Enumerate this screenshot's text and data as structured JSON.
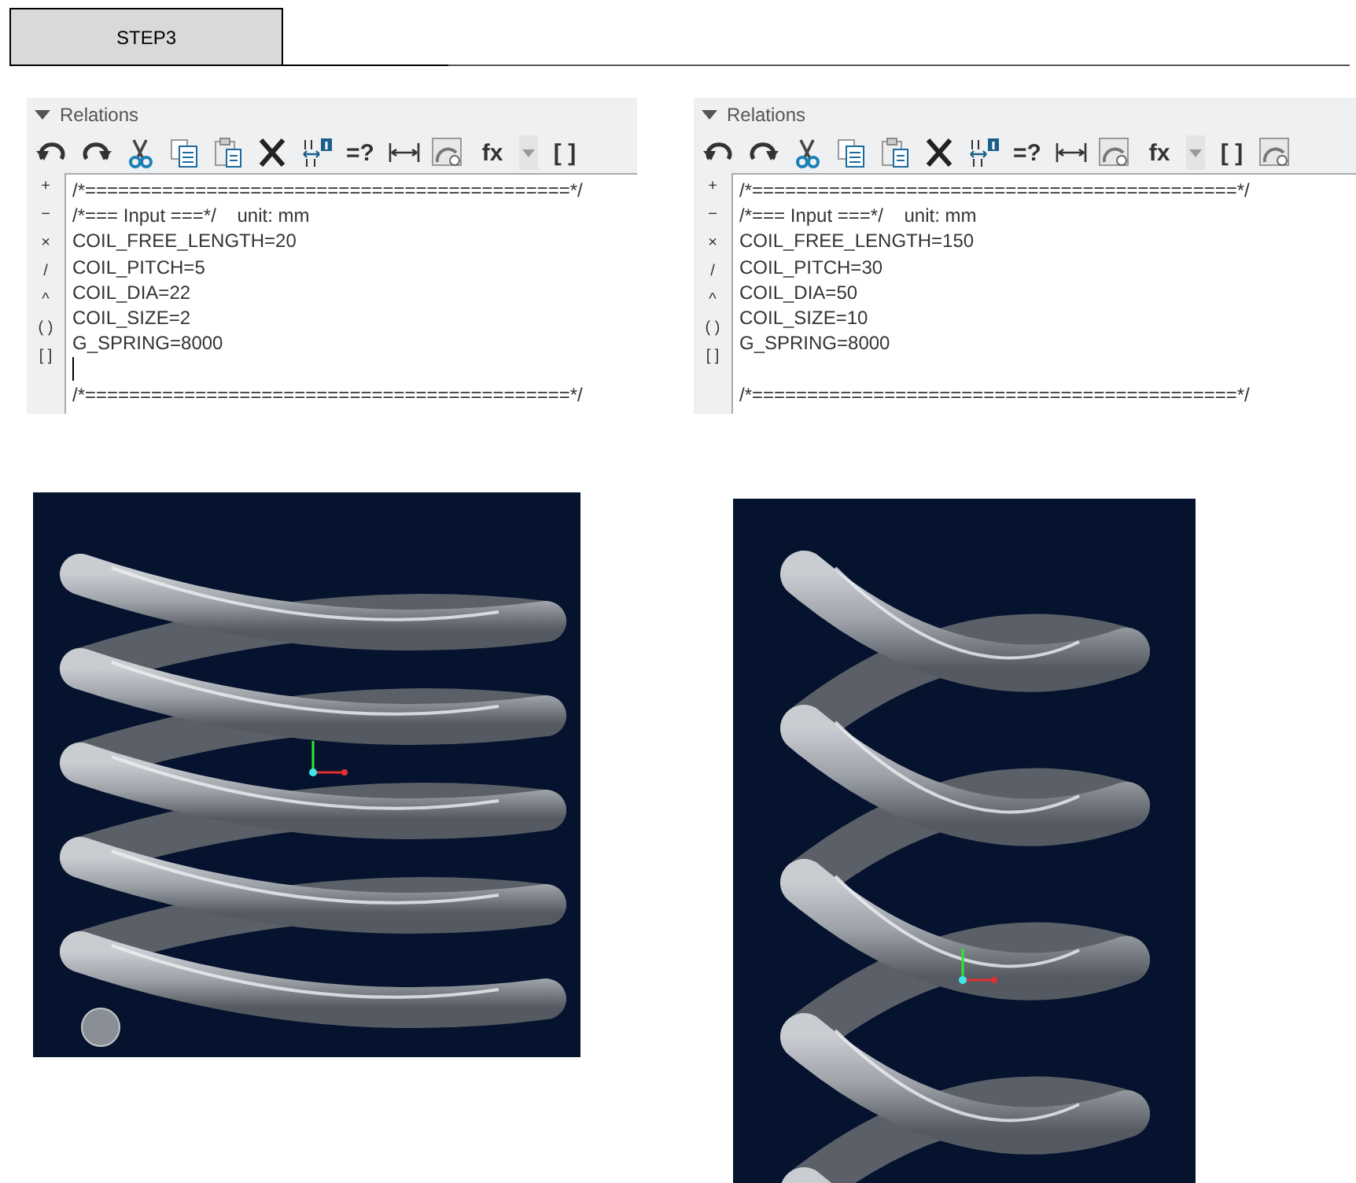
{
  "step_tab": {
    "label": "STEP3"
  },
  "panels": [
    {
      "title": "Relations",
      "toolbar": [
        {
          "kind": "undo"
        },
        {
          "kind": "redo"
        },
        {
          "kind": "cut"
        },
        {
          "kind": "copy"
        },
        {
          "kind": "paste"
        },
        {
          "kind": "delete"
        },
        {
          "kind": "dim-info"
        },
        {
          "kind": "text",
          "label": "=?"
        },
        {
          "kind": "dimension"
        },
        {
          "kind": "chart"
        },
        {
          "kind": "text",
          "label": "fx"
        },
        {
          "kind": "dropdown"
        },
        {
          "kind": "text",
          "label": "[ ]"
        }
      ],
      "operators": [
        "+",
        "−",
        "×",
        "/",
        "^",
        "( )",
        "[ ]"
      ],
      "lines": [
        "/*============================================*/",
        "/*=== Input ===*/    unit: mm",
        "COIL_FREE_LENGTH=20",
        "COIL_PITCH=5",
        "COIL_DIA=22",
        "COIL_SIZE=2",
        "G_SPRING=8000"
      ],
      "caret": true,
      "footer_lines": [
        "/*============================================*/"
      ]
    },
    {
      "title": "Relations",
      "toolbar": [
        {
          "kind": "undo"
        },
        {
          "kind": "redo"
        },
        {
          "kind": "cut"
        },
        {
          "kind": "copy"
        },
        {
          "kind": "paste"
        },
        {
          "kind": "delete"
        },
        {
          "kind": "dim-info"
        },
        {
          "kind": "text",
          "label": "=?"
        },
        {
          "kind": "dimension"
        },
        {
          "kind": "chart"
        },
        {
          "kind": "text",
          "label": "fx"
        },
        {
          "kind": "dropdown"
        },
        {
          "kind": "text",
          "label": "[ ]"
        },
        {
          "kind": "chart"
        }
      ],
      "operators": [
        "+",
        "−",
        "×",
        "/",
        "^",
        "( )",
        "[ ]"
      ],
      "lines": [
        "/*============================================*/",
        "/*=== Input ===*/    unit: mm",
        "COIL_FREE_LENGTH=150",
        "COIL_PITCH=30",
        "COIL_DIA=50",
        "COIL_SIZE=10",
        "G_SPRING=8000"
      ],
      "caret": false,
      "footer_lines": [
        "/*============================================*/"
      ]
    }
  ]
}
